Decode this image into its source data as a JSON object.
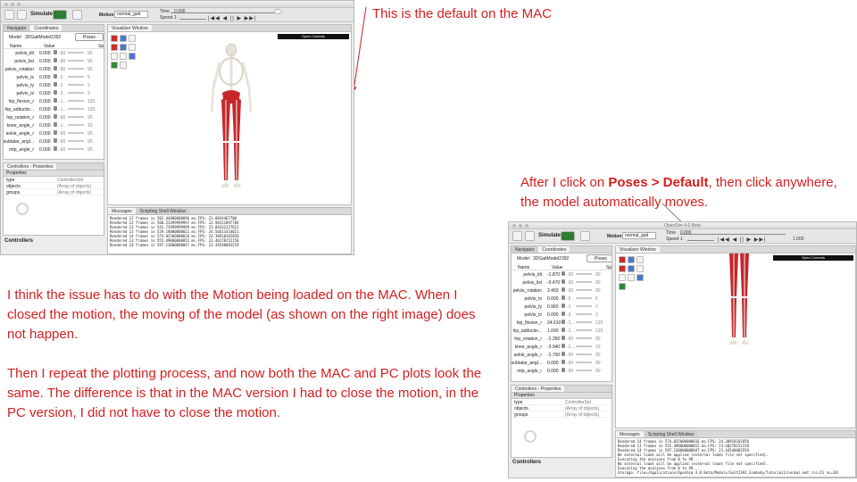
{
  "notes": {
    "top": "This is the default on the MAC",
    "right_prefix": "After I click on ",
    "right_bold": "Poses > Default",
    "right_suffix": ", then click anywhere, the model automatically moves.",
    "body_p1": "I think the issue has to do with the Motion being loaded on the MAC. When I closed the motion, the moving of the model (as shown on the right image) does not happen.",
    "body_p2": "Then I repeat the plotting process, and now both the MAC and PC plots look the same. The difference is that in the MAC version I had to close the motion, in the PC version, I did not have to close the motion."
  },
  "colors": {
    "note": "#d41f1f",
    "muscle": "#c8262b",
    "bone": "#e6e2d8",
    "toolbar_green": "#2e7d32"
  },
  "app": {
    "title": "OpenSim 4.0 Beta",
    "simulate_label": "Simulate",
    "motion_label": "Motion:",
    "motion_value": "normal_gait",
    "time_label": "Time",
    "time_value": "0.000",
    "speed_label": "Speed",
    "speed_value": "1",
    "speed_value_right": "1.000",
    "playback_icons": "|◀◀ ◀ || ▶ ▶▶|",
    "tabs_nav": [
      "Navigator",
      "Coordinates"
    ],
    "model_label": "Model:",
    "model_name": "3DGaitModel2392",
    "poses_label": "Poses",
    "col_name": "Name",
    "col_value": "Value",
    "col_sp": "Sp",
    "props_tab": "Controllers - Properties",
    "props_header": "Properties",
    "props": [
      {
        "key": "type",
        "val": "ControllerSet"
      },
      {
        "key": "objects",
        "val": "(Array of objects)"
      },
      {
        "key": "groups",
        "val": "(Array of objects)"
      }
    ],
    "controllers_label": "Controllers",
    "viz_tab": "Visualizer Window",
    "open_controls": "Open Controls",
    "msg_tabs": [
      "Messages",
      "Scripting Shell Window"
    ]
  },
  "left_coords": [
    {
      "name": "pelvis_tilt",
      "value": "0.000",
      "min": "-90",
      "max": "90"
    },
    {
      "name": "pelvis_list",
      "value": "0.000",
      "min": "-90",
      "max": "90"
    },
    {
      "name": "pelvis_rotation",
      "value": "0.000",
      "min": "-90",
      "max": "90"
    },
    {
      "name": "pelvis_tx",
      "value": "0.000",
      "min": "-5",
      "max": "5"
    },
    {
      "name": "pelvis_ty",
      "value": "0.000",
      "min": "-1",
      "max": "2"
    },
    {
      "name": "pelvis_tz",
      "value": "0.000",
      "min": "-3",
      "max": "3"
    },
    {
      "name": "hip_flexion_r",
      "value": "0.000",
      "min": "-1...",
      "max": "120"
    },
    {
      "name": "hip_adductio...",
      "value": "0.000",
      "min": "-1...",
      "max": "120"
    },
    {
      "name": "hip_rotation_r",
      "value": "0.000",
      "min": "-90",
      "max": "90"
    },
    {
      "name": "knee_angle_r",
      "value": "0.000",
      "min": "-1...",
      "max": "10"
    },
    {
      "name": "ankle_angle_r",
      "value": "0.000",
      "min": "-90",
      "max": "90"
    },
    {
      "name": "subtalar_angl...",
      "value": "0.000",
      "min": "-90",
      "max": "90"
    },
    {
      "name": "mtp_angle_r",
      "value": "0.000",
      "min": "-90",
      "max": "90"
    }
  ],
  "right_coords": [
    {
      "name": "pelvis_tilt",
      "value": "-1.870",
      "min": "-90",
      "max": "90"
    },
    {
      "name": "pelvis_list",
      "value": "-0.470",
      "min": "-90",
      "max": "90"
    },
    {
      "name": "pelvis_rotation",
      "value": "2.450",
      "min": "-90",
      "max": "90"
    },
    {
      "name": "pelvis_tx",
      "value": "0.000",
      "min": "-5",
      "max": "5"
    },
    {
      "name": "pelvis_ty",
      "value": "0.960",
      "min": "-1",
      "max": "2"
    },
    {
      "name": "pelvis_tz",
      "value": "0.000",
      "min": "-3",
      "max": "3"
    },
    {
      "name": "hip_flexion_r",
      "value": "24.610",
      "min": "-1...",
      "max": "120"
    },
    {
      "name": "hip_adductio...",
      "value": "1.090",
      "min": "-1...",
      "max": "120"
    },
    {
      "name": "hip_rotation_r",
      "value": "-1.350",
      "min": "-90",
      "max": "90"
    },
    {
      "name": "knee_angle_r",
      "value": "-3.940",
      "min": "-1...",
      "max": "10"
    },
    {
      "name": "ankle_angle_r",
      "value": "-1.700",
      "min": "-90",
      "max": "90"
    },
    {
      "name": "subtalar_angl...",
      "value": "0.000",
      "min": "-90",
      "max": "90"
    },
    {
      "name": "mtp_angle_r",
      "value": "0.000",
      "min": "-90",
      "max": "90"
    }
  ],
  "left_log": [
    "Rendered 12 frames in 502.44800000096 ms.FPS: 23.8834467700",
    "Rendered 12 frames in 500.22499999997 ms.FPS: 23.98311097784",
    "Rendered 13 frames in 541.72999999999 ms.FPS: 23.84331227621",
    "Rendered 13 frames in 529.18000000021 ms.FPS: 24.56613314021",
    "Rendered 14 frames in 574.02500000016 ms.FPS: 24.38918165850",
    "Rendered 13 frames in 555.49000000052 ms.FPS: 23.40278152158",
    "Rendered 14 frames in 597.13000000047 ms.FPS: 23.44548083559"
  ],
  "right_log": [
    "Rendered 14 frames in 574.025000000016 ms.FPS: 24.38918165850",
    "Rendered 13 frames in 555.490000000052 ms.FPS: 23.40278152158",
    "Rendered 14 frames in 597.130000000047 ms.FPS: 23.44548083559",
    "No external loads will be applied (external loads file not specified).",
    "Executing the analyses from 0 to 99...",
    "No external loads will be applied (external loads file not specified).",
    "Executing the analyses from 0 to 99...",
    "Storage: file=/Applications/OpenSim 4.0 Beta/Models/Gait2392_Simbody/Tutorial1/normal.mot (nr=51 nc=18)"
  ]
}
